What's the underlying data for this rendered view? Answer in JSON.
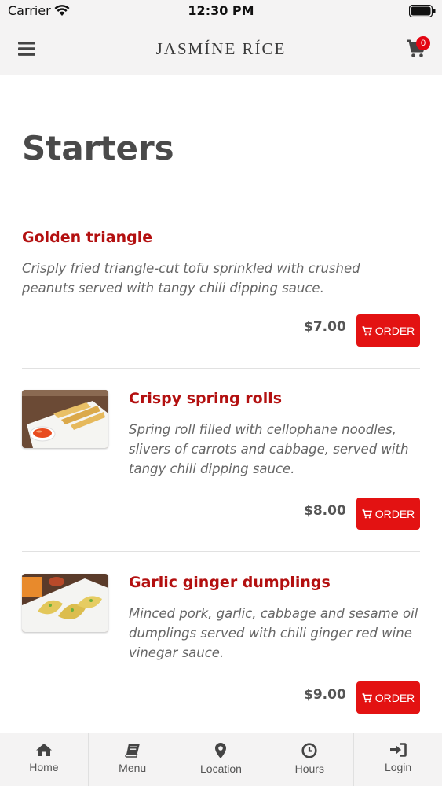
{
  "status_bar": {
    "carrier": "Carrier",
    "time": "12:30 PM"
  },
  "header": {
    "logo": "JASMÍNE RÍCE",
    "cart_count": "0"
  },
  "page": {
    "title": "Starters"
  },
  "items": [
    {
      "name": "Golden triangle",
      "description": "Crisply fried triangle-cut tofu sprinkled with crushed peanuts served with tangy chili dipping sauce.",
      "price": "$7.00",
      "order_label": "ORDER",
      "has_image": false
    },
    {
      "name": "Crispy spring rolls",
      "description": "Spring roll filled with cellophane noodles, slivers of carrots and cabbage, served with tangy chili dipping sauce.",
      "price": "$8.00",
      "order_label": "ORDER",
      "has_image": true
    },
    {
      "name": "Garlic ginger dumplings",
      "description": "Minced pork, garlic, cabbage and sesame oil dumplings served with chili ginger red wine vinegar sauce.",
      "price": "$9.00",
      "order_label": "ORDER",
      "has_image": true
    }
  ],
  "tabs": [
    {
      "label": "Home",
      "icon": "home-icon"
    },
    {
      "label": "Menu",
      "icon": "book-icon"
    },
    {
      "label": "Location",
      "icon": "map-pin-icon"
    },
    {
      "label": "Hours",
      "icon": "clock-icon"
    },
    {
      "label": "Login",
      "icon": "login-icon"
    }
  ],
  "colors": {
    "accent": "#e31212",
    "item_name": "#b31010",
    "bar_bg": "#f4f3f3"
  }
}
